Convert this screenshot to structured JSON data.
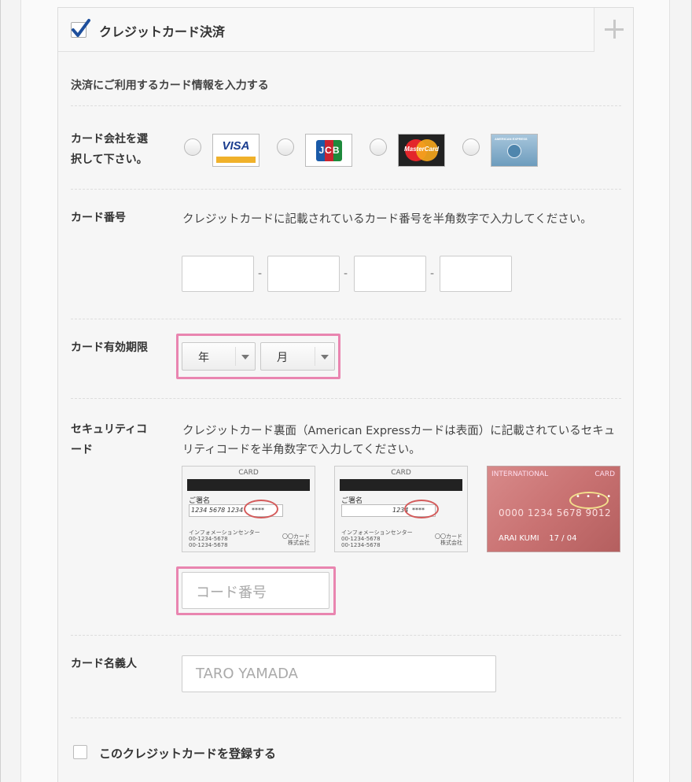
{
  "header": {
    "title": "クレジットカード決済"
  },
  "intro": "決済にご利用するカード情報を入力する",
  "card_company": {
    "label": "カード会社を選択して下さい。",
    "brands": [
      {
        "name": "VISA",
        "icon": "visa-logo"
      },
      {
        "name": "JCB",
        "icon": "jcb-logo"
      },
      {
        "name": "MasterCard",
        "icon": "mastercard-logo"
      },
      {
        "name": "AMERICAN EXPRESS",
        "icon": "amex-logo"
      }
    ]
  },
  "card_number": {
    "label": "カード番号",
    "description": "クレジットカードに記載されているカード番号を半角数字で入力してください。",
    "separator": "-"
  },
  "expiry": {
    "label": "カード有効期限",
    "year": "年",
    "month": "月"
  },
  "security": {
    "label": "セキュリティコード",
    "description": "クレジットカード裏面（American Expressカードは表面）に記載されているセキュリティコードを半角数字で入力してください。",
    "card_title": "CARD",
    "sign_label": "ご署名",
    "number_a": "1234  5678  1234",
    "number_b": "1234",
    "masked": "****",
    "info_center": "インフォメーションセンター",
    "info_phone": "00-1234-5678",
    "corp_line1": "〇〇カード",
    "corp_line2": "株式会社",
    "amex_left": "INTERNATIONAL",
    "amex_right": "CARD",
    "amex_dots": "• • • •",
    "amex_number": "0000  1234  5678  9012",
    "amex_name": "ARAI KUMI",
    "amex_expiry": "17 / 04",
    "placeholder": "コード番号"
  },
  "holder": {
    "label": "カード名義人",
    "placeholder": "TARO YAMADA"
  },
  "register": {
    "label": "このクレジットカードを登録する"
  },
  "colors": {
    "highlight": "#e985b0",
    "check": "#1e4f9c"
  }
}
